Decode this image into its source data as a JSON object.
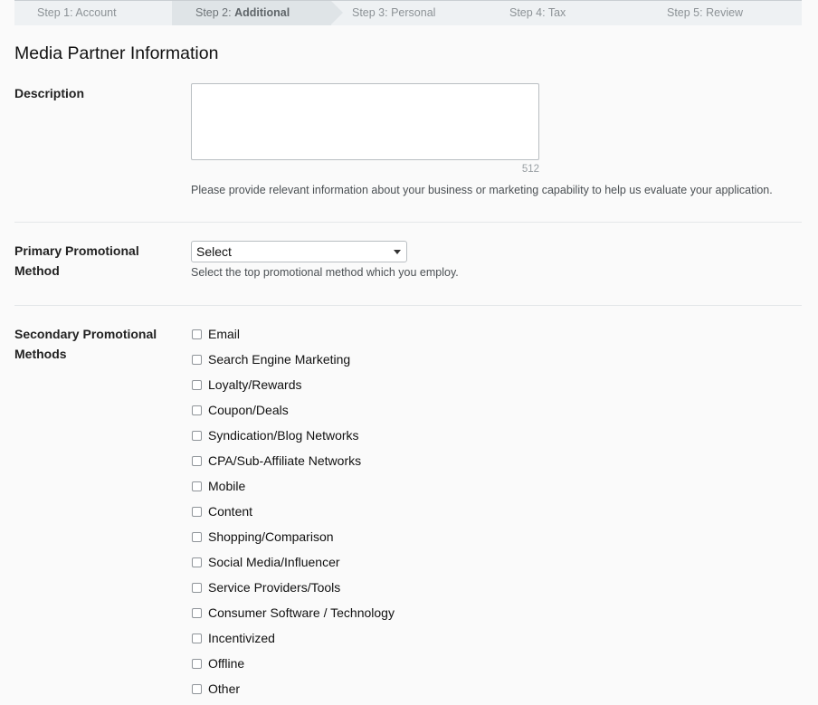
{
  "stepper": {
    "steps": [
      {
        "prefix": "Step 1: ",
        "label": "Account"
      },
      {
        "prefix": "Step 2: ",
        "label": "Additional"
      },
      {
        "prefix": "Step 3: ",
        "label": "Personal"
      },
      {
        "prefix": "Step 4: ",
        "label": "Tax"
      },
      {
        "prefix": "Step 5: ",
        "label": "Review"
      }
    ],
    "active_index": 1
  },
  "section_title": "Media Partner Information",
  "description": {
    "label": "Description",
    "value": "",
    "char_count": "512",
    "help": "Please provide relevant information about your business or marketing capability to help us evaluate your application."
  },
  "primary": {
    "label_line1": "Primary Promotional",
    "label_line2": "Method",
    "selected": "Select",
    "help": "Select the top promotional method which you employ."
  },
  "secondary": {
    "label_line1": "Secondary Promotional",
    "label_line2": "Methods",
    "options": [
      {
        "label": "Email",
        "checked": false
      },
      {
        "label": "Search Engine Marketing",
        "checked": false
      },
      {
        "label": "Loyalty/Rewards",
        "checked": false
      },
      {
        "label": "Coupon/Deals",
        "checked": false
      },
      {
        "label": "Syndication/Blog Networks",
        "checked": false
      },
      {
        "label": "CPA/Sub-Affiliate Networks",
        "checked": false
      },
      {
        "label": "Mobile",
        "checked": false
      },
      {
        "label": "Content",
        "checked": false
      },
      {
        "label": "Shopping/Comparison",
        "checked": false
      },
      {
        "label": "Social Media/Influencer",
        "checked": false
      },
      {
        "label": "Service Providers/Tools",
        "checked": false
      },
      {
        "label": "Consumer Software / Technology",
        "checked": false
      },
      {
        "label": "Incentivized",
        "checked": false
      },
      {
        "label": "Offline",
        "checked": false
      },
      {
        "label": "Other",
        "checked": false
      }
    ]
  }
}
